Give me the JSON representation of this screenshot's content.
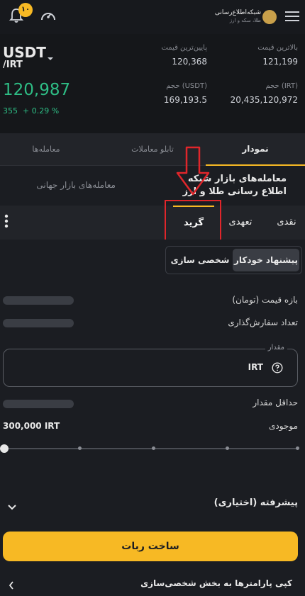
{
  "header": {
    "menu_icon": "hamburger-icon",
    "logo_title": "شبکه‌اطلاع‌رسانی",
    "logo_subtitle": "طلا، سکه و ارز",
    "speed_icon": "gauge-icon",
    "bell_icon": "bell-icon",
    "notification_count": "۱۰"
  },
  "market": {
    "symbol": "USDT",
    "quote": "/IRT",
    "price": "120,987",
    "change_abs": "355",
    "change_pct": "+ 0.29 %",
    "high_label": "بالاترین قیمت",
    "high_value": "121,199",
    "low_label": "پایین‌ترین قیمت",
    "low_value": "120,368",
    "vol_irt_label": "حجم (IRT)",
    "vol_irt_value": "20,435,120,972",
    "vol_usdt_label": "حجم (USDT)",
    "vol_usdt_value": "169,193.5"
  },
  "tabs_primary": [
    "نمودار",
    "تابلو معاملات",
    "معامله‌ها"
  ],
  "tabs_secondary": {
    "active": "معامله‌های بازار شبکه اطلاع رسانی طلا و ارز",
    "inactive": "معامله‌های بازار جهانی"
  },
  "trade_types": [
    "نقدی",
    "تعهدی",
    "گرید"
  ],
  "mode_toggle": [
    "پیشنهاد خودکار",
    "شخصی سازی"
  ],
  "form": {
    "price_range_label": "بازه قیمت (تومان)",
    "order_count_label": "تعداد سفارش‌گذاری",
    "amount_label": "مقدار",
    "amount_currency": "IRT",
    "min_amount_label": "حداقل مقدار",
    "balance_label": "موجودی",
    "balance_value": "300,000 IRT",
    "slider_percent": 0
  },
  "advanced_label": "پیشرفته (اختیاری)",
  "submit_label": "ساخت ربات",
  "copy_params_label": "کپی پارامترها به بخش شخصی‌سازی",
  "colors": {
    "accent": "#f7b924",
    "positive": "#2ebd85",
    "annotation": "#e0262b"
  }
}
